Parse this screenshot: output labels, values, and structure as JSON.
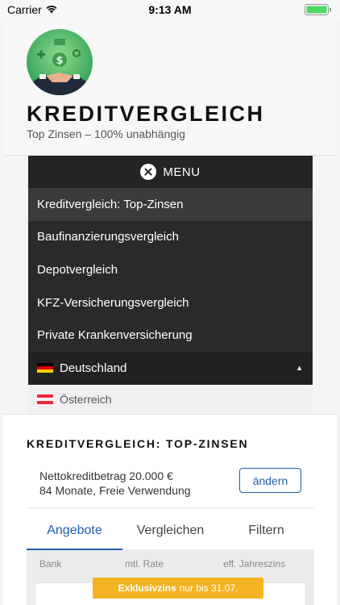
{
  "status_bar": {
    "carrier": "Carrier",
    "time": "9:13 AM"
  },
  "header": {
    "title": "KREDITVERGLEICH",
    "tagline": "Top Zinsen – 100% unabhängig"
  },
  "menu": {
    "toggle_label": "MENU",
    "items": [
      {
        "label": "Kreditvergleich: Top-Zinsen",
        "active": true
      },
      {
        "label": "Baufinanzierungsvergleich"
      },
      {
        "label": "Depotvergleich"
      },
      {
        "label": "KFZ-Versicherungsvergleich"
      },
      {
        "label": "Private Krankenversicherung"
      }
    ],
    "language": {
      "current": "Deutschland",
      "option": "Österreich"
    }
  },
  "content": {
    "section_title": "KREDITVERGLEICH: TOP-ZINSEN",
    "loan_summary": {
      "line1": "Nettokreditbetrag 20.000 €",
      "line2": "84 Monate, Freie Verwendung"
    },
    "change_label": "ändern",
    "tabs": [
      {
        "label": "Angebote",
        "active": true
      },
      {
        "label": "Vergleichen"
      },
      {
        "label": "Filtern"
      }
    ],
    "columns": [
      "Bank",
      "mtl. Rate",
      "eff. Jahreszins"
    ],
    "badge": {
      "bold": "Exklusivzins",
      "text": "nur bis 31.07."
    }
  },
  "colors": {
    "accent": "#1f5fa8",
    "menu_bg": "#2a2a2a",
    "badge": "#f4b321"
  }
}
